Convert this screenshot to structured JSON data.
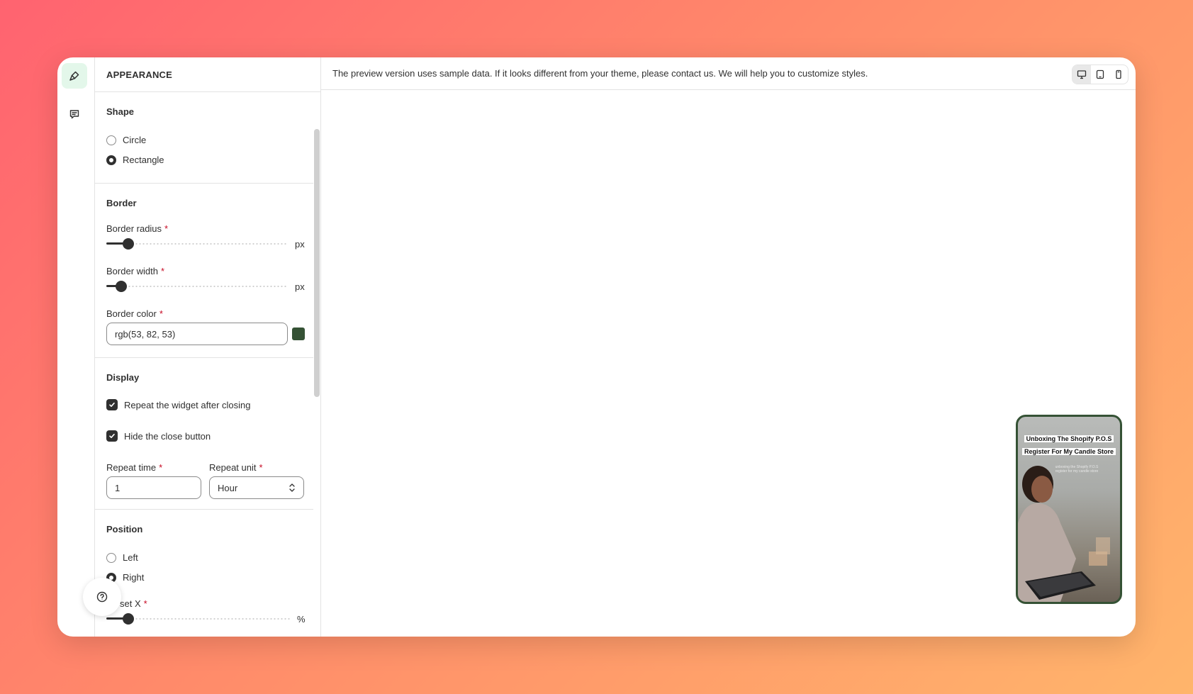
{
  "panel": {
    "header": "APPEARANCE",
    "shape": {
      "title": "Shape",
      "options": [
        {
          "label": "Circle",
          "checked": false
        },
        {
          "label": "Rectangle",
          "checked": true
        }
      ]
    },
    "border": {
      "title": "Border",
      "radius_label": "Border radius",
      "radius_unit": "px",
      "width_label": "Border width",
      "width_unit": "px",
      "color_label": "Border color",
      "color_value": "rgb(53, 82, 53)",
      "color_hex": "#355235"
    },
    "display": {
      "title": "Display",
      "repeat_label": "Repeat the widget after closing",
      "hide_close_label": "Hide the close button",
      "repeat_time_label": "Repeat time",
      "repeat_time_value": "1",
      "repeat_unit_label": "Repeat unit",
      "repeat_unit_value": "Hour"
    },
    "position": {
      "title": "Position",
      "options": [
        {
          "label": "Left",
          "checked": false
        },
        {
          "label": "Right",
          "checked": true
        }
      ],
      "offset_x_label": "set X",
      "offset_x_unit": "%"
    }
  },
  "preview": {
    "notice": "The preview version uses sample data. If it looks different from your theme, please contact us. We will help you to customize styles.",
    "video_caption": "Unboxing The Shopify P.O.S Register For My Candle Store",
    "video_subtext": "unboxing the Shopify P.O.S register for my candle store"
  },
  "icons": {
    "rail": [
      "paintbrush-icon",
      "chat-bubble-icon"
    ],
    "devices": [
      "desktop-icon",
      "tablet-icon",
      "mobile-icon"
    ],
    "help": "question-mark-icon"
  },
  "colors": {
    "accent_active_bg": "#e3f7ea",
    "border_color": "#355235",
    "required": "#c70a24"
  }
}
